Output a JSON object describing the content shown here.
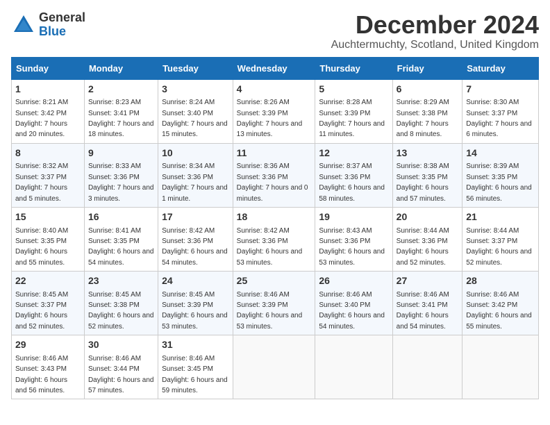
{
  "logo": {
    "general": "General",
    "blue": "Blue"
  },
  "calendar": {
    "title": "December 2024",
    "subtitle": "Auchtermuchty, Scotland, United Kingdom",
    "days_of_week": [
      "Sunday",
      "Monday",
      "Tuesday",
      "Wednesday",
      "Thursday",
      "Friday",
      "Saturday"
    ],
    "weeks": [
      [
        {
          "day": "1",
          "sunrise": "8:21 AM",
          "sunset": "3:42 PM",
          "daylight": "7 hours and 20 minutes."
        },
        {
          "day": "2",
          "sunrise": "8:23 AM",
          "sunset": "3:41 PM",
          "daylight": "7 hours and 18 minutes."
        },
        {
          "day": "3",
          "sunrise": "8:24 AM",
          "sunset": "3:40 PM",
          "daylight": "7 hours and 15 minutes."
        },
        {
          "day": "4",
          "sunrise": "8:26 AM",
          "sunset": "3:39 PM",
          "daylight": "7 hours and 13 minutes."
        },
        {
          "day": "5",
          "sunrise": "8:28 AM",
          "sunset": "3:39 PM",
          "daylight": "7 hours and 11 minutes."
        },
        {
          "day": "6",
          "sunrise": "8:29 AM",
          "sunset": "3:38 PM",
          "daylight": "7 hours and 8 minutes."
        },
        {
          "day": "7",
          "sunrise": "8:30 AM",
          "sunset": "3:37 PM",
          "daylight": "7 hours and 6 minutes."
        }
      ],
      [
        {
          "day": "8",
          "sunrise": "8:32 AM",
          "sunset": "3:37 PM",
          "daylight": "7 hours and 5 minutes."
        },
        {
          "day": "9",
          "sunrise": "8:33 AM",
          "sunset": "3:36 PM",
          "daylight": "7 hours and 3 minutes."
        },
        {
          "day": "10",
          "sunrise": "8:34 AM",
          "sunset": "3:36 PM",
          "daylight": "7 hours and 1 minute."
        },
        {
          "day": "11",
          "sunrise": "8:36 AM",
          "sunset": "3:36 PM",
          "daylight": "7 hours and 0 minutes."
        },
        {
          "day": "12",
          "sunrise": "8:37 AM",
          "sunset": "3:36 PM",
          "daylight": "6 hours and 58 minutes."
        },
        {
          "day": "13",
          "sunrise": "8:38 AM",
          "sunset": "3:35 PM",
          "daylight": "6 hours and 57 minutes."
        },
        {
          "day": "14",
          "sunrise": "8:39 AM",
          "sunset": "3:35 PM",
          "daylight": "6 hours and 56 minutes."
        }
      ],
      [
        {
          "day": "15",
          "sunrise": "8:40 AM",
          "sunset": "3:35 PM",
          "daylight": "6 hours and 55 minutes."
        },
        {
          "day": "16",
          "sunrise": "8:41 AM",
          "sunset": "3:35 PM",
          "daylight": "6 hours and 54 minutes."
        },
        {
          "day": "17",
          "sunrise": "8:42 AM",
          "sunset": "3:36 PM",
          "daylight": "6 hours and 54 minutes."
        },
        {
          "day": "18",
          "sunrise": "8:42 AM",
          "sunset": "3:36 PM",
          "daylight": "6 hours and 53 minutes."
        },
        {
          "day": "19",
          "sunrise": "8:43 AM",
          "sunset": "3:36 PM",
          "daylight": "6 hours and 53 minutes."
        },
        {
          "day": "20",
          "sunrise": "8:44 AM",
          "sunset": "3:36 PM",
          "daylight": "6 hours and 52 minutes."
        },
        {
          "day": "21",
          "sunrise": "8:44 AM",
          "sunset": "3:37 PM",
          "daylight": "6 hours and 52 minutes."
        }
      ],
      [
        {
          "day": "22",
          "sunrise": "8:45 AM",
          "sunset": "3:37 PM",
          "daylight": "6 hours and 52 minutes."
        },
        {
          "day": "23",
          "sunrise": "8:45 AM",
          "sunset": "3:38 PM",
          "daylight": "6 hours and 52 minutes."
        },
        {
          "day": "24",
          "sunrise": "8:45 AM",
          "sunset": "3:39 PM",
          "daylight": "6 hours and 53 minutes."
        },
        {
          "day": "25",
          "sunrise": "8:46 AM",
          "sunset": "3:39 PM",
          "daylight": "6 hours and 53 minutes."
        },
        {
          "day": "26",
          "sunrise": "8:46 AM",
          "sunset": "3:40 PM",
          "daylight": "6 hours and 54 minutes."
        },
        {
          "day": "27",
          "sunrise": "8:46 AM",
          "sunset": "3:41 PM",
          "daylight": "6 hours and 54 minutes."
        },
        {
          "day": "28",
          "sunrise": "8:46 AM",
          "sunset": "3:42 PM",
          "daylight": "6 hours and 55 minutes."
        }
      ],
      [
        {
          "day": "29",
          "sunrise": "8:46 AM",
          "sunset": "3:43 PM",
          "daylight": "6 hours and 56 minutes."
        },
        {
          "day": "30",
          "sunrise": "8:46 AM",
          "sunset": "3:44 PM",
          "daylight": "6 hours and 57 minutes."
        },
        {
          "day": "31",
          "sunrise": "8:46 AM",
          "sunset": "3:45 PM",
          "daylight": "6 hours and 59 minutes."
        },
        null,
        null,
        null,
        null
      ]
    ]
  }
}
